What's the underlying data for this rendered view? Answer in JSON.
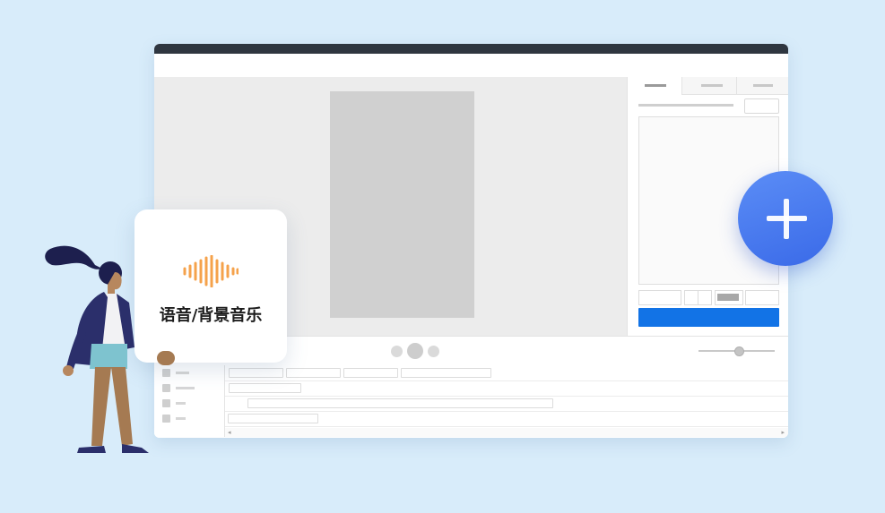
{
  "feature_card": {
    "title": "语音/背景音乐",
    "icon": "sound-wave-icon",
    "icon_color": "#f5a24b"
  },
  "add_button": {
    "icon": "plus-icon",
    "color": "#4a7cf0"
  },
  "apply_button": {
    "color": "#1273e6"
  },
  "colors": {
    "background": "#d8ecfa",
    "titlebar": "#2f3640",
    "workspace": "#ececec",
    "canvas": "#d0d0d0",
    "figure_jacket": "#2b2f6b",
    "figure_skirt": "#7ec3cf",
    "figure_pants": "#a57a52"
  }
}
